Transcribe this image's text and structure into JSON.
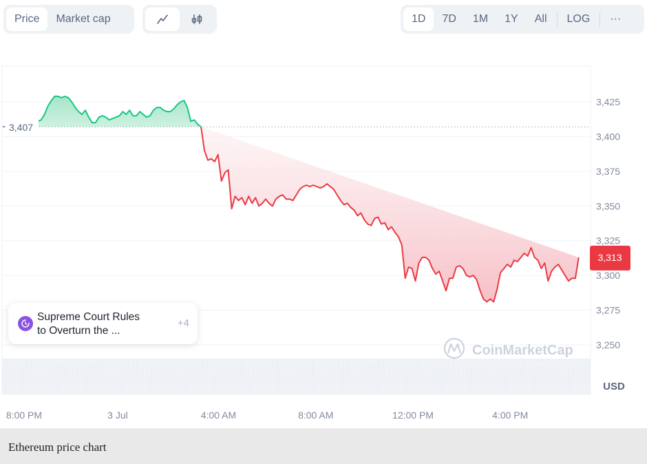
{
  "toolbar": {
    "view_tabs": [
      {
        "label": "Price",
        "active": true
      },
      {
        "label": "Market cap",
        "active": false
      }
    ],
    "chart_type_buttons": [
      {
        "icon": "line-chart-icon",
        "active": true
      },
      {
        "icon": "candlestick-icon",
        "active": false
      }
    ],
    "range_buttons": [
      {
        "label": "1D",
        "active": true
      },
      {
        "label": "7D",
        "active": false
      },
      {
        "label": "1M",
        "active": false
      },
      {
        "label": "1Y",
        "active": false
      },
      {
        "label": "All",
        "active": false
      }
    ],
    "log_label": "LOG",
    "more_label": "···"
  },
  "news": {
    "title": "Supreme Court Rules to Overturn the ...",
    "line1": "Supreme Court Rules",
    "line2": "to Overturn the ...",
    "more_count": "+4",
    "icon": "news-history-icon"
  },
  "watermark": "CoinMarketCap",
  "caption": "Ethereum price chart",
  "colors": {
    "up": "#16c784",
    "down": "#ea3943",
    "up_fill": "#b9ebd4",
    "down_fill": "#fbe2e4",
    "axis_text": "#808a9d",
    "current_badge": "#ea3943"
  },
  "chart_data": {
    "type": "area",
    "title": "Ethereum price chart",
    "currency_label": "USD",
    "reference_price": 3407,
    "reference_label": "3,407",
    "current_price": 3313,
    "current_label": "3,313",
    "ylim": [
      3237,
      3445
    ],
    "yticks": [
      3250,
      3275,
      3300,
      3325,
      3350,
      3375,
      3400,
      3425
    ],
    "ytick_labels": [
      "3,250",
      "3,275",
      "3,300",
      "3,325",
      "3,350",
      "3,375",
      "3,400",
      "3,425"
    ],
    "xlim_hours": [
      -0.98,
      23.1
    ],
    "xticks_hours": [
      0,
      3.85,
      8,
      12,
      16,
      20
    ],
    "xtick_labels": [
      "8:00 PM",
      "3 Jul",
      "4:00 AM",
      "8:00 AM",
      "12:00 PM",
      "4:00 PM"
    ],
    "x_unit": "hours since 8:00 PM",
    "grid": true,
    "series": [
      {
        "name": "ETH/USD",
        "x_hours": [
          0.42,
          0.56,
          0.7,
          0.84,
          0.98,
          1.12,
          1.26,
          1.4,
          1.54,
          1.68,
          1.82,
          1.96,
          2.1,
          2.24,
          2.38,
          2.52,
          2.66,
          2.8,
          2.94,
          3.08,
          3.22,
          3.36,
          3.5,
          3.64,
          3.78,
          3.92,
          4.06,
          4.2,
          4.34,
          4.48,
          4.62,
          4.76,
          4.9,
          5.04,
          5.18,
          5.32,
          5.46,
          5.6,
          5.74,
          5.88,
          6.02,
          6.16,
          6.3,
          6.44,
          6.58,
          6.72,
          6.86,
          7.0,
          7.14,
          7.28,
          7.42,
          7.56,
          7.7,
          7.84,
          7.98,
          8.12,
          8.26,
          8.4,
          8.54,
          8.68,
          8.82,
          8.96,
          9.1,
          9.24,
          9.38,
          9.52,
          9.66,
          9.8,
          9.94,
          10.08,
          10.22,
          10.36,
          10.5,
          10.64,
          10.78,
          10.92,
          11.06,
          11.2,
          11.34,
          11.48,
          11.62,
          11.76,
          11.9,
          12.04,
          12.18,
          12.32,
          12.46,
          12.6,
          12.74,
          12.88,
          13.02,
          13.16,
          13.3,
          13.44,
          13.58,
          13.72,
          13.86,
          14.0,
          14.14,
          14.28,
          14.42,
          14.56,
          14.7,
          14.84,
          14.98,
          15.12,
          15.26,
          15.4,
          15.54,
          15.68,
          15.82,
          15.96,
          16.1,
          16.24,
          16.38,
          16.52,
          16.66,
          16.8,
          16.94,
          17.08,
          17.22,
          17.36,
          17.5,
          17.64,
          17.78,
          17.92,
          18.06,
          18.2,
          18.34,
          18.48,
          18.62,
          18.76,
          18.9,
          19.04,
          19.18,
          19.32,
          19.46,
          19.6,
          19.74,
          19.88,
          20.02,
          20.16,
          20.3,
          20.44,
          20.58,
          20.72,
          20.86,
          21.0,
          21.14,
          21.28,
          21.42,
          21.56,
          21.7,
          21.84,
          21.98,
          22.12,
          22.26,
          22.4,
          22.54,
          22.68,
          22.82,
          22.96,
          23.1
        ],
        "values": [
          3410,
          3411,
          3412,
          3416,
          3422,
          3426,
          3429,
          3429,
          3428,
          3429,
          3428,
          3425,
          3421,
          3418,
          3416,
          3419,
          3414,
          3410,
          3410,
          3414,
          3415,
          3414,
          3412,
          3413,
          3414,
          3415,
          3418,
          3416,
          3419,
          3415,
          3415,
          3418,
          3416,
          3414,
          3415,
          3419,
          3421,
          3421,
          3419,
          3418,
          3418,
          3420,
          3423,
          3425,
          3426,
          3421,
          3411,
          3412,
          3409,
          3407,
          3390,
          3383,
          3384,
          3382,
          3387,
          3368,
          3374,
          3376,
          3348,
          3357,
          3354,
          3356,
          3351,
          3357,
          3352,
          3356,
          3350,
          3352,
          3355,
          3352,
          3350,
          3355,
          3357,
          3358,
          3355,
          3355,
          3354,
          3358,
          3362,
          3364,
          3365,
          3364,
          3365,
          3364,
          3363,
          3364,
          3366,
          3364,
          3362,
          3358,
          3354,
          3351,
          3352,
          3349,
          3347,
          3343,
          3345,
          3340,
          3337,
          3336,
          3341,
          3342,
          3337,
          3338,
          3333,
          3335,
          3331,
          3328,
          3322,
          3298,
          3306,
          3305,
          3296,
          3309,
          3313,
          3313,
          3311,
          3305,
          3301,
          3303,
          3296,
          3289,
          3298,
          3298,
          3306,
          3307,
          3305,
          3300,
          3299,
          3300,
          3297,
          3289,
          3283,
          3281,
          3283,
          3281,
          3290,
          3302,
          3305,
          3308,
          3306,
          3311,
          3310,
          3313,
          3316,
          3314,
          3320,
          3313,
          3311,
          3305,
          3309,
          3296,
          3303,
          3306,
          3308,
          3304,
          3300,
          3296,
          3298,
          3298,
          3313
        ]
      }
    ],
    "watermark": "CoinMarketCap"
  }
}
